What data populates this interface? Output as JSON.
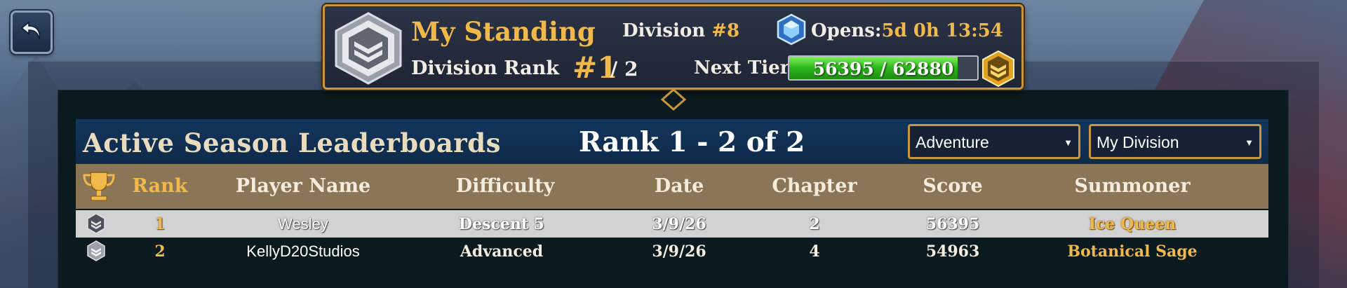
{
  "standing": {
    "title": "My Standing",
    "division_label": "Division",
    "division_number": "#8",
    "opens_label": "Opens:",
    "opens_time": "5d 0h 13:54",
    "division_rank_label": "Division Rank",
    "rank": "#1",
    "rank_total": "/ 2",
    "next_tier_label": "Next Tier",
    "tier_progress_text": "56395 / 62880",
    "tier_progress_fraction": 0.897
  },
  "leaderboard": {
    "title": "Active Season Leaderboards",
    "range": "Rank 1 - 2 of 2",
    "mode_select": "Adventure",
    "scope_select": "My Division"
  },
  "table": {
    "columns": [
      "Rank",
      "Player Name",
      "Difficulty",
      "Date",
      "Chapter",
      "Score",
      "Summoner"
    ],
    "rows": [
      {
        "rank": "1",
        "player": "Wesley",
        "difficulty": "Descent 5",
        "date": "3/9/26",
        "chapter": "2",
        "score": "56395",
        "summoner": "Ice Queen"
      },
      {
        "rank": "2",
        "player": "KellyD20Studios",
        "difficulty": "Advanced",
        "date": "3/9/26",
        "chapter": "4",
        "score": "54963",
        "summoner": "Botanical Sage"
      }
    ]
  },
  "icons": {
    "back": "back-arrow-icon",
    "tier_badge": "tier-hexagon-icon",
    "gem": "diamond-gem-icon",
    "trophy": "trophy-icon"
  },
  "colors": {
    "gold": "#f1b84a",
    "frame_gold": "#c9963c",
    "header_blue": "#13365c",
    "table_head": "#8a7556",
    "progress_green": "#2ab51a"
  }
}
